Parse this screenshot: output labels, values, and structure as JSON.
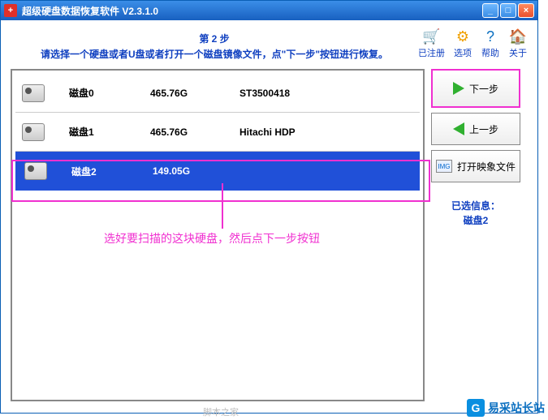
{
  "titlebar": {
    "app_icon_text": "+",
    "title": "超级硬盘数据恢复软件  V2.3.1.0"
  },
  "instructions": {
    "step": "第 2 步",
    "text": "请选择一个硬盘或者U盘或者打开一个磁盘镜像文件，点\"下一步\"按钮进行恢复。"
  },
  "toolbar": {
    "registered": "已注册",
    "options": "选项",
    "help": "帮助",
    "about": "关于"
  },
  "disks": [
    {
      "name": "磁盘0",
      "size": "465.76G",
      "model": "ST3500418"
    },
    {
      "name": "磁盘1",
      "size": "465.76G",
      "model": "Hitachi HDP"
    },
    {
      "name": "磁盘2",
      "size": "149.05G",
      "model": ""
    }
  ],
  "side": {
    "next": "下一步",
    "prev": "上一步",
    "open_image": "打开映象文件",
    "selected_label": "已选信息：",
    "selected_value": "磁盘2"
  },
  "annotation": {
    "text": "选好要扫描的这块硬盘，然后点下一步按钮"
  },
  "footer_fade": "脚本之家",
  "watermark": {
    "icon": "G",
    "text": "易采站长站"
  }
}
